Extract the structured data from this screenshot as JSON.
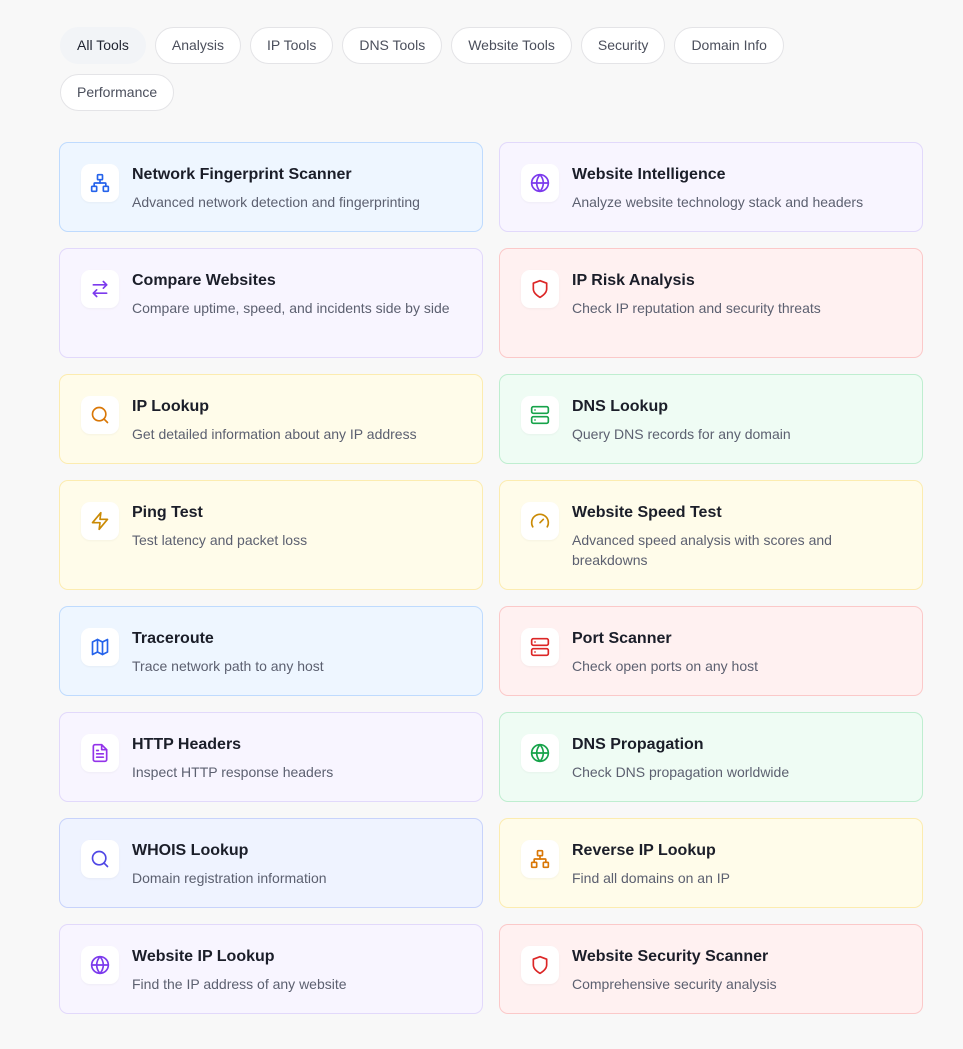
{
  "filters": [
    {
      "label": "All Tools",
      "active": true
    },
    {
      "label": "Analysis"
    },
    {
      "label": "IP Tools"
    },
    {
      "label": "DNS Tools"
    },
    {
      "label": "Website Tools"
    },
    {
      "label": "Security"
    },
    {
      "label": "Domain Info"
    },
    {
      "label": "Performance"
    }
  ],
  "tools": [
    {
      "title": "Network Fingerprint Scanner",
      "description": "Advanced network detection and fingerprinting",
      "icon": "network-icon",
      "theme": "blue",
      "color": "#2563eb"
    },
    {
      "title": "Website Intelligence",
      "description": "Analyze website technology stack and headers",
      "icon": "globe-icon",
      "theme": "violet",
      "color": "#7c3aed"
    },
    {
      "title": "Compare Websites",
      "description": "Compare uptime, speed, and incidents side by side",
      "icon": "arrows-swap-icon",
      "theme": "violet",
      "color": "#7c3aed"
    },
    {
      "title": "IP Risk Analysis",
      "description": "Check IP reputation and security threats",
      "icon": "shield-icon",
      "theme": "red",
      "color": "#dc2626"
    },
    {
      "title": "IP Lookup",
      "description": "Get detailed information about any IP address",
      "icon": "search-icon",
      "theme": "yellow",
      "color": "#d97706"
    },
    {
      "title": "DNS Lookup",
      "description": "Query DNS records for any domain",
      "icon": "server-icon",
      "theme": "green",
      "color": "#16a34a"
    },
    {
      "title": "Ping Test",
      "description": "Test latency and packet loss",
      "icon": "zap-icon",
      "theme": "yellow",
      "color": "#ca8a04"
    },
    {
      "title": "Website Speed Test",
      "description": "Advanced speed analysis with scores and breakdowns",
      "icon": "gauge-icon",
      "theme": "yellow",
      "color": "#ca8a04"
    },
    {
      "title": "Traceroute",
      "description": "Trace network path to any host",
      "icon": "map-icon",
      "theme": "blue",
      "color": "#2563eb"
    },
    {
      "title": "Port Scanner",
      "description": "Check open ports on any host",
      "icon": "server-icon",
      "theme": "red",
      "color": "#dc2626"
    },
    {
      "title": "HTTP Headers",
      "description": "Inspect HTTP response headers",
      "icon": "file-text-icon",
      "theme": "violet",
      "color": "#9333ea"
    },
    {
      "title": "DNS Propagation",
      "description": "Check DNS propagation worldwide",
      "icon": "globe-icon",
      "theme": "green",
      "color": "#16a34a"
    },
    {
      "title": "WHOIS Lookup",
      "description": "Domain registration information",
      "icon": "search-icon",
      "theme": "indigo",
      "color": "#4f46e5"
    },
    {
      "title": "Reverse IP Lookup",
      "description": "Find all domains on an IP",
      "icon": "network-icon",
      "theme": "yellow",
      "color": "#d97706"
    },
    {
      "title": "Website IP Lookup",
      "description": "Find the IP address of any website",
      "icon": "globe-icon",
      "theme": "violet",
      "color": "#7c3aed"
    },
    {
      "title": "Website Security Scanner",
      "description": "Comprehensive security analysis",
      "icon": "shield-icon",
      "theme": "red",
      "color": "#dc2626"
    }
  ]
}
